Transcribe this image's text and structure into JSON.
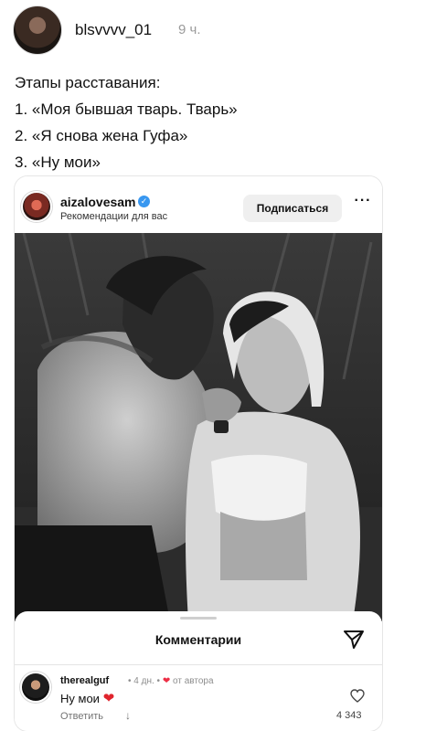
{
  "post": {
    "author": "blsvvvv_01",
    "time": "9 ч.",
    "lines": [
      "Этапы расставания:",
      "1. «Моя бывшая тварь. Тварь»",
      "2. «Я снова жена Гуфа»",
      "3. «Ну мои»"
    ]
  },
  "embed": {
    "username": "aizalovesam",
    "subtitle": "Рекомендации для вас",
    "follow_label": "Подписаться",
    "more_label": "···"
  },
  "comments": {
    "title": "Комментарии",
    "items": [
      {
        "user": "therealguf",
        "time": "4 дн.",
        "from_author": "от автора",
        "text": "Ну мои",
        "reply_label": "Ответить",
        "likes": "4 343"
      }
    ]
  },
  "colors": {
    "verified": "#3897f0",
    "heart": "#e0242d",
    "follow_bg": "#efefef",
    "muted_text": "#8e8e8e"
  },
  "icons": [
    "verified-badge-icon",
    "more-dots-icon",
    "send-icon",
    "heart-icon",
    "like-heart-icon",
    "reply-arrow-icon"
  ]
}
